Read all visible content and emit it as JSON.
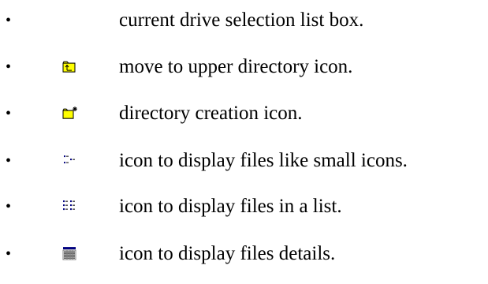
{
  "items": [
    {
      "bullet": "•",
      "icon": "",
      "text": "current drive selection list box."
    },
    {
      "bullet": "•",
      "icon": "folder-up-icon",
      "text": "move to upper directory icon."
    },
    {
      "bullet": "•",
      "icon": "new-folder-icon",
      "text": "directory creation icon."
    },
    {
      "bullet": "•",
      "icon": "small-icons-view-icon",
      "text": "icon to display files like small icons."
    },
    {
      "bullet": "•",
      "icon": "list-view-icon",
      "text": "icon to display files in a list."
    },
    {
      "bullet": "•",
      "icon": "details-view-icon",
      "text": "icon to display files details."
    }
  ]
}
